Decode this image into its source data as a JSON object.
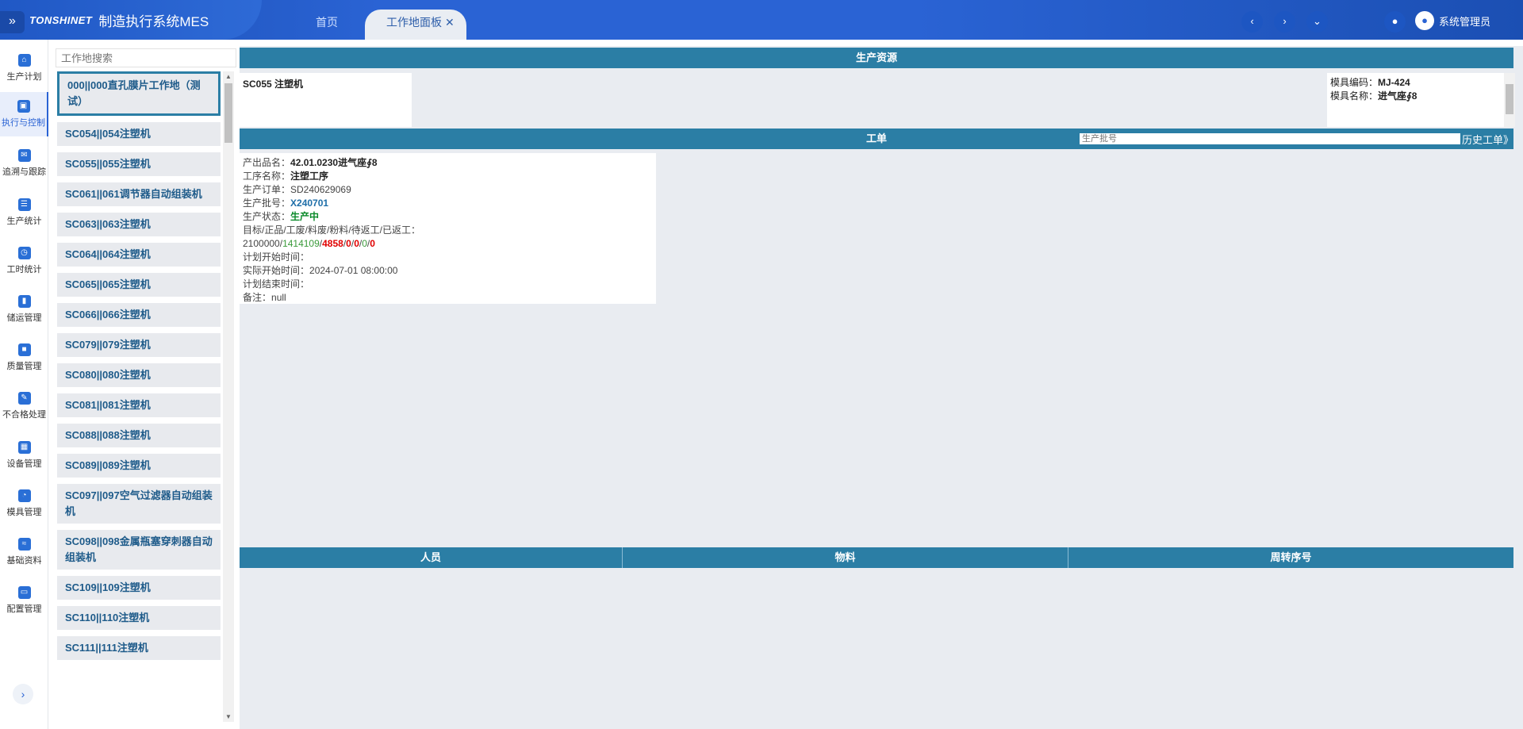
{
  "header": {
    "brand_logo": "TONSHINET",
    "brand_title": "制造执行系统MES",
    "tabs": [
      {
        "label": "首页"
      },
      {
        "label": "工作地面板"
      }
    ],
    "user_name": "系统管理员"
  },
  "nav": {
    "items": [
      {
        "label": "生产计划",
        "icon": "home-icon"
      },
      {
        "label": "执行与控制",
        "icon": "save-icon",
        "active": true
      },
      {
        "label": "追溯与跟踪",
        "icon": "chat-icon"
      },
      {
        "label": "生产统计",
        "icon": "list-icon"
      },
      {
        "label": "工时统计",
        "icon": "clock-icon"
      },
      {
        "label": "储运管理",
        "icon": "book-icon"
      },
      {
        "label": "质量管理",
        "icon": "chart-icon"
      },
      {
        "label": "不合格处理",
        "icon": "edit-icon"
      },
      {
        "label": "设备管理",
        "icon": "calendar-icon"
      },
      {
        "label": "模具管理",
        "icon": "pie-icon"
      },
      {
        "label": "基础资料",
        "icon": "database-icon"
      },
      {
        "label": "配置管理",
        "icon": "monitor-icon"
      }
    ]
  },
  "workstations": {
    "search_placeholder": "工作地搜索",
    "items": [
      "000||000直孔膜片工作地（测试）",
      "SC054||054注塑机",
      "SC055||055注塑机",
      "SC061||061调节器自动组装机",
      "SC063||063注塑机",
      "SC064||064注塑机",
      "SC065||065注塑机",
      "SC066||066注塑机",
      "SC079||079注塑机",
      "SC080||080注塑机",
      "SC081||081注塑机",
      "SC088||088注塑机",
      "SC089||089注塑机",
      "SC097||097空气过滤器自动组装机",
      "SC098||098金属瓶塞穿刺器自动组装机",
      "SC109||109注塑机",
      "SC110||110注塑机",
      "SC111||111注塑机"
    ]
  },
  "resources": {
    "section_title": "生产资源",
    "machine": "SC055 注塑机",
    "mold_code_label": "模具编码：",
    "mold_code": "MJ-424",
    "mold_name_label": "模具名称：",
    "mold_name": "进气座∮8"
  },
  "work_order": {
    "section_title": "工单",
    "batch_search_placeholder": "生产批号",
    "history_button": "历史工单》",
    "product_label": "产出品名：",
    "product_value": "42.01.0230进气座∮8",
    "process_label": "工序名称：",
    "process_value": "注塑工序",
    "order_label": "生产订单：",
    "order_value": "SD240629069",
    "batch_label": "生产批号：",
    "batch_value": "X240701",
    "status_label": "生产状态：",
    "status_value": "生产中",
    "counts_label": "目标/正品/工废/料废/粉料/待返工/已返工：",
    "target": "2100000",
    "good": "1414109",
    "scrap_proc": "4858",
    "scrap_mat": "0",
    "powder": "0",
    "pending_rework": "0",
    "reworked": "0",
    "sep": "/",
    "plan_start_label": "计划开始时间：",
    "actual_start_label": "实际开始时间：",
    "actual_start_value": "2024-07-01 08:00:00",
    "plan_end_label": "计划结束时间：",
    "remark_label": "备注：",
    "remark_value": "null"
  },
  "bottom": {
    "personnel": "人员",
    "material": "物料",
    "turnover_no": "周转序号"
  }
}
